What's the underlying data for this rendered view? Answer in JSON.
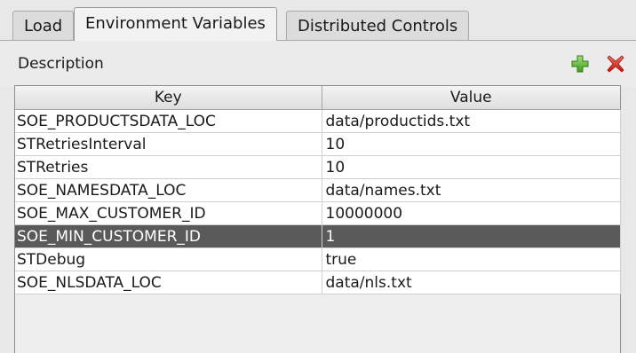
{
  "tabs": [
    {
      "label": "Load",
      "active": false
    },
    {
      "label": "Environment Variables",
      "active": true
    },
    {
      "label": "Distributed Controls",
      "active": false
    }
  ],
  "panel": {
    "description_label": "Description",
    "add_icon": "plus-icon",
    "remove_icon": "close-icon"
  },
  "table": {
    "columns": [
      "Key",
      "Value"
    ],
    "rows": [
      {
        "key": "SOE_PRODUCTSDATA_LOC",
        "value": "data/productids.txt"
      },
      {
        "key": "STRetriesInterval",
        "value": "10"
      },
      {
        "key": "STRetries",
        "value": "10"
      },
      {
        "key": "SOE_NAMESDATA_LOC",
        "value": "data/names.txt"
      },
      {
        "key": "SOE_MAX_CUSTOMER_ID",
        "value": "10000000"
      },
      {
        "key": "SOE_MIN_CUSTOMER_ID",
        "value": "1",
        "selected": true
      },
      {
        "key": "STDebug",
        "value": "true"
      },
      {
        "key": "SOE_NLSDATA_LOC",
        "value": "data/nls.txt"
      }
    ]
  },
  "colors": {
    "add": "#5cb82e",
    "remove": "#d8261c",
    "selection": "#5a5a5a"
  }
}
